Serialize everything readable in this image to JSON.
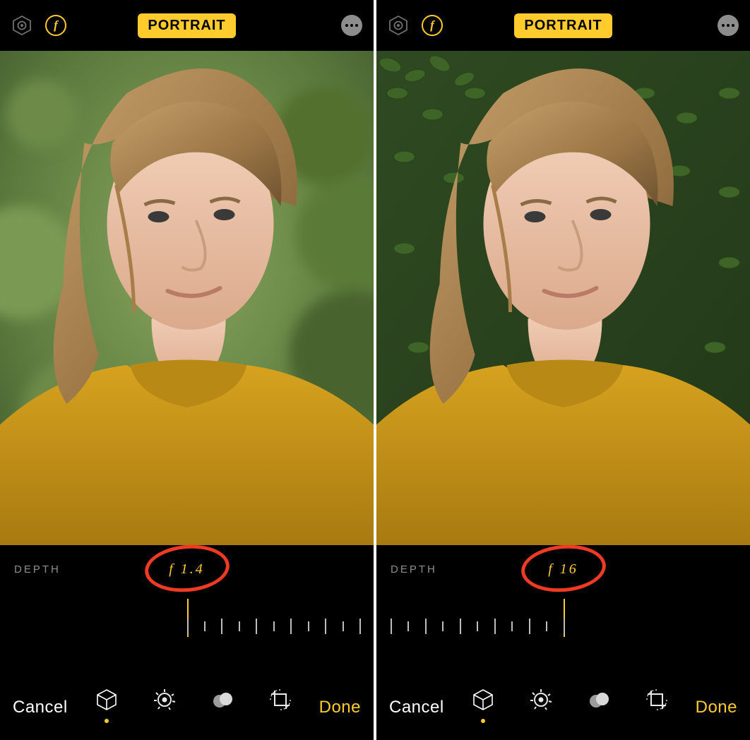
{
  "screens": [
    {
      "mode_label": "PORTRAIT",
      "depth_label": "DEPTH",
      "f_value_display": "f 1.4",
      "slider_position": "left",
      "cancel_label": "Cancel",
      "done_label": "Done",
      "photo_blur": "heavy"
    },
    {
      "mode_label": "PORTRAIT",
      "depth_label": "DEPTH",
      "f_value_display": "f 16",
      "slider_position": "right",
      "cancel_label": "Cancel",
      "done_label": "Done",
      "photo_blur": "none"
    }
  ],
  "icons": {
    "lighting": "hex-aperture-icon",
    "fstop": "f-icon",
    "more": "more-icon",
    "portrait_cube": "cube-icon",
    "adjust": "adjust-dial-icon",
    "filters": "filters-overlap-icon",
    "crop": "crop-rotate-icon"
  },
  "colors": {
    "accent": "#ffcb2d",
    "annotation": "#ef3a24",
    "muted": "#8e8e8e"
  }
}
